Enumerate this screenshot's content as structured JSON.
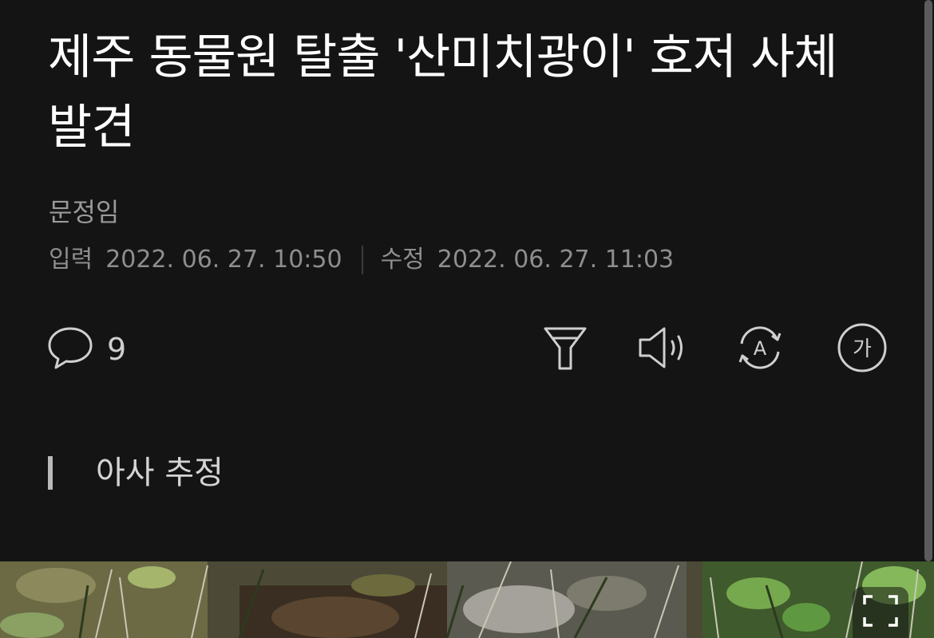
{
  "article": {
    "title": "제주 동물원 탈출 '산미치광이' 호저 사체 발견",
    "author": "문정임",
    "published_label": "입력",
    "published": "2022. 06. 27. 10:50",
    "modified_label": "수정",
    "modified": "2022. 06. 27. 11:03",
    "subheading": "아사 추정"
  },
  "toolbar": {
    "comment_count": "9",
    "icons": [
      "comment-icon",
      "filter-icon",
      "speaker-icon",
      "translate-icon",
      "font-size-icon"
    ],
    "font_size_glyph": "가",
    "translate_glyph": "A"
  },
  "image": {
    "expand_icon": "expand-icon"
  },
  "colors": {
    "background": "#141414",
    "title": "#ffffff",
    "meta": "#8e8e8e",
    "icon": "#cfcfcf"
  }
}
